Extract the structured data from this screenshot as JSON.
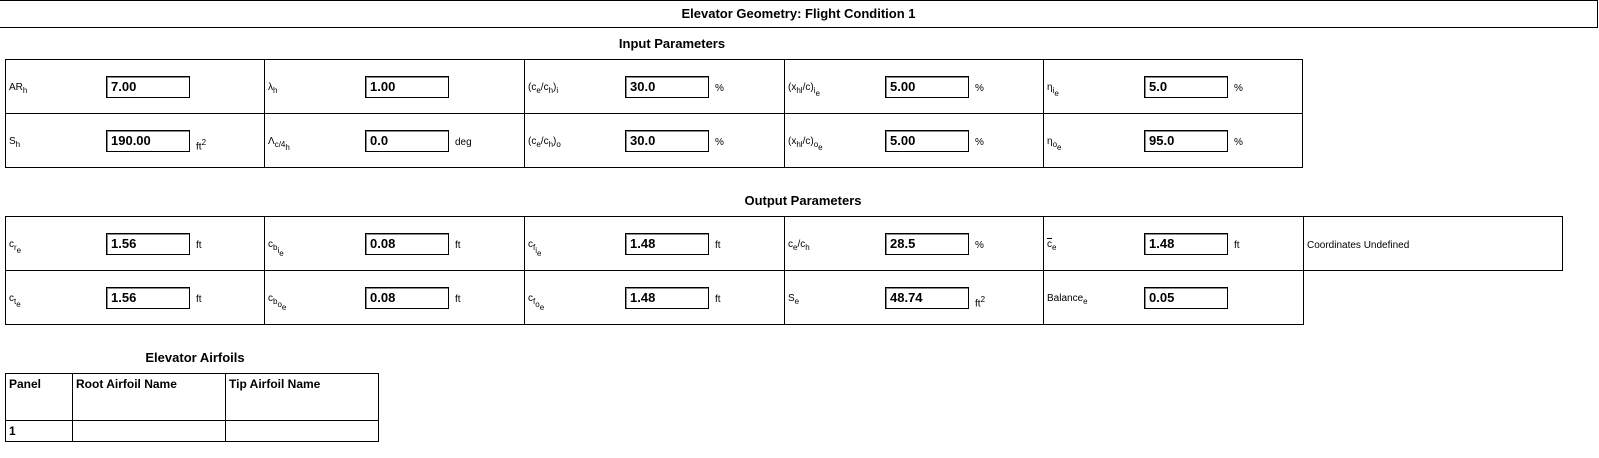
{
  "header": {
    "title": "Elevator Geometry: Flight Condition 1"
  },
  "sections": {
    "input_title": "Input Parameters",
    "output_title": "Output Parameters",
    "airfoils_title": "Elevator Airfoils"
  },
  "inputs": {
    "ar_h": {
      "value": "7.00"
    },
    "lambda_h": {
      "value": "1.00"
    },
    "ce_ch_i": {
      "value": "30.0",
      "unit": "%"
    },
    "xhl_c_i": {
      "value": "5.00",
      "unit": "%"
    },
    "eta_i": {
      "value": "5.0",
      "unit": "%"
    },
    "s_h": {
      "value": "190.00",
      "unit": "ft",
      "unit_exp": "2"
    },
    "sweep_c4": {
      "value": "0.0",
      "unit": "deg"
    },
    "ce_ch_o": {
      "value": "30.0",
      "unit": "%"
    },
    "xhl_c_o": {
      "value": "5.00",
      "unit": "%"
    },
    "eta_o": {
      "value": "95.0",
      "unit": "%"
    }
  },
  "outputs": {
    "cr_e": {
      "value": "1.56",
      "unit": "ft"
    },
    "cb_i": {
      "value": "0.08",
      "unit": "ft"
    },
    "cf_i": {
      "value": "1.48",
      "unit": "ft"
    },
    "ce_ch": {
      "value": "28.5",
      "unit": "%"
    },
    "cbar_e": {
      "value": "1.48",
      "unit": "ft"
    },
    "coordinates_note": "Coordinates Undefined",
    "ct_e": {
      "value": "1.56",
      "unit": "ft"
    },
    "cb_o": {
      "value": "0.08",
      "unit": "ft"
    },
    "cf_o": {
      "value": "1.48",
      "unit": "ft"
    },
    "s_e": {
      "value": "48.74",
      "unit": "ft",
      "unit_exp": "2"
    },
    "balance": {
      "value": "0.05",
      "label": "Balance"
    }
  },
  "airfoils": {
    "headers": [
      "Panel",
      "Root Airfoil Name",
      "Tip Airfoil Name"
    ],
    "rows": [
      {
        "panel": "1",
        "root": "",
        "tip": ""
      }
    ]
  }
}
